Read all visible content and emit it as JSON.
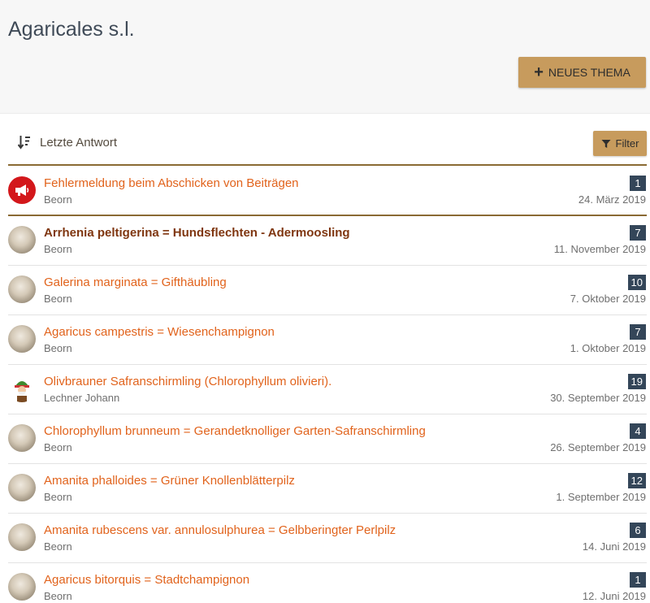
{
  "header": {
    "title": "Agaricales s.l.",
    "new_topic_label": "NEUES THEMA"
  },
  "toolbar": {
    "sort_label": "Letzte Antwort",
    "filter_label": "Filter"
  },
  "colors": {
    "accent": "#c79b5d",
    "link": "#e1631c",
    "unread_link": "#7f3610",
    "badge": "#344659",
    "announce": "#d3171b"
  },
  "topics": [
    {
      "title": "Fehlermeldung beim Abschicken von Beiträgen",
      "author": "Beorn",
      "replies": "1",
      "date": "24. März 2019",
      "avatar": "megaphone-icon",
      "sticky": true
    },
    {
      "title": "Arrhenia peltigerina = Hundsflechten - Adermoosling",
      "author": "Beorn",
      "replies": "7",
      "date": "11. November 2019",
      "avatar": "mushroom-avatar",
      "unread": true
    },
    {
      "title": "Galerina marginata = Gifthäubling",
      "author": "Beorn",
      "replies": "10",
      "date": "7. Oktober 2019",
      "avatar": "mushroom-avatar"
    },
    {
      "title": "Agaricus campestris = Wiesenchampignon",
      "author": "Beorn",
      "replies": "7",
      "date": "1. Oktober 2019",
      "avatar": "mushroom-avatar"
    },
    {
      "title": "Olivbrauner Safranschirmling (Chlorophyllum olivieri).",
      "author": "Lechner Johann",
      "replies": "19",
      "date": "30. September 2019",
      "avatar": "gnome-avatar"
    },
    {
      "title": "Chlorophyllum brunneum = Gerandetknolliger Garten-Safranschirmling",
      "author": "Beorn",
      "replies": "4",
      "date": "26. September 2019",
      "avatar": "mushroom-avatar"
    },
    {
      "title": "Amanita phalloides = Grüner Knollenblätterpilz",
      "author": "Beorn",
      "replies": "12",
      "date": "1. September 2019",
      "avatar": "mushroom-avatar"
    },
    {
      "title": "Amanita rubescens var. annulosulphurea = Gelbberingter Perlpilz",
      "author": "Beorn",
      "replies": "6",
      "date": "14. Juni 2019",
      "avatar": "mushroom-avatar"
    },
    {
      "title": "Agaricus bitorquis = Stadtchampignon",
      "author": "Beorn",
      "replies": "1",
      "date": "12. Juni 2019",
      "avatar": "mushroom-avatar"
    }
  ]
}
